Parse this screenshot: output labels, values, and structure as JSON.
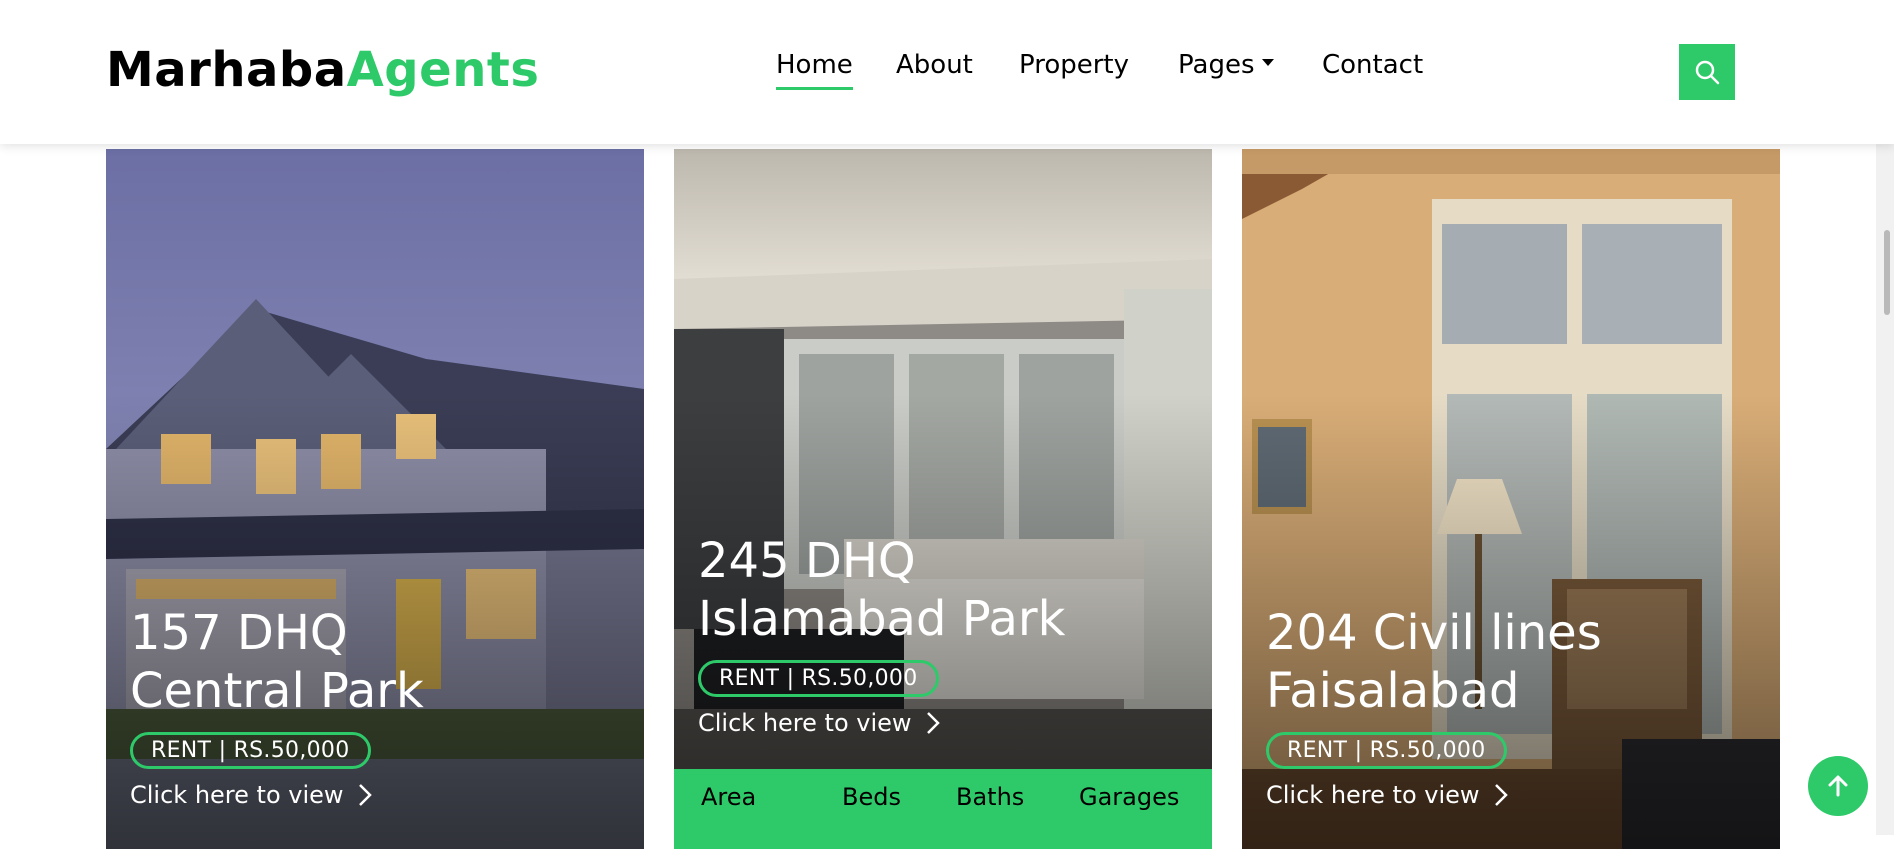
{
  "brand": {
    "part1": "Marhaba",
    "part2": "Agents"
  },
  "nav": {
    "items": [
      {
        "label": "Home",
        "active": true
      },
      {
        "label": "About"
      },
      {
        "label": "Property"
      },
      {
        "label": "Pages",
        "dropdown": true
      },
      {
        "label": "Contact"
      }
    ],
    "search_icon": "search-icon"
  },
  "colors": {
    "accent": "#2eca6a",
    "text": "#000000",
    "header_bg": "#ffffff"
  },
  "cards": [
    {
      "title_line1": "157 DHQ",
      "title_line2": "Central Park",
      "price": "RENT | RS.50,000",
      "link": "Click here to view"
    },
    {
      "title_line1": "245 DHQ",
      "title_line2": "Islamabad Park",
      "price": "RENT | RS.50,000",
      "link": "Click here to view",
      "stats": [
        {
          "label": "Area"
        },
        {
          "label": "Beds"
        },
        {
          "label": "Baths"
        },
        {
          "label": "Garages"
        }
      ]
    },
    {
      "title_line1": "204 Civil lines",
      "title_line2": "Faisalabad",
      "price": "RENT | RS.50,000",
      "link": "Click here to view"
    }
  ],
  "back_to_top_icon": "arrow-up-icon"
}
